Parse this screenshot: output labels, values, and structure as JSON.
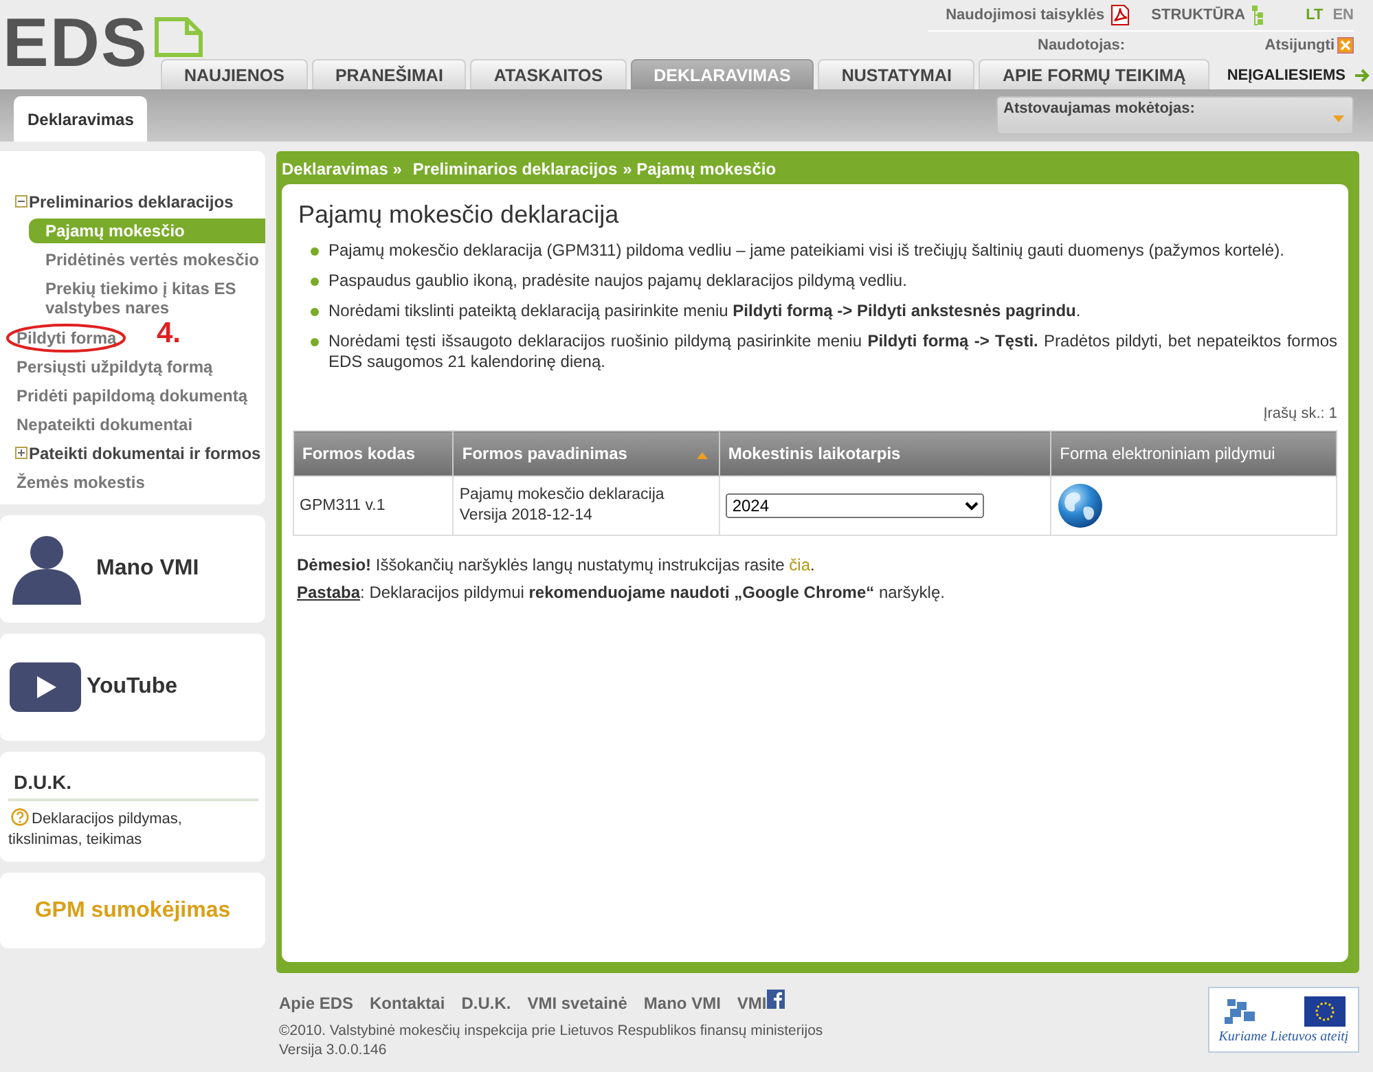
{
  "logo": {
    "text": "EDS"
  },
  "top_links": [
    {
      "label": "Naudojimosi taisyklės",
      "kind": "pdf"
    },
    {
      "label": "STRUKTŪRA",
      "kind": "tree"
    }
  ],
  "languages": [
    {
      "label": "LT",
      "selected": true
    },
    {
      "label": "EN",
      "selected": false
    }
  ],
  "user_label": "Naudotojas:",
  "logout": "Atsijungti",
  "tabs": [
    {
      "label": "NAUJIENOS",
      "selected": false
    },
    {
      "label": "PRANEŠIMAI",
      "selected": false
    },
    {
      "label": "ATASKAITOS",
      "selected": false
    },
    {
      "label": "DEKLARAVIMAS",
      "selected": true
    },
    {
      "label": "NUSTATYMAI",
      "selected": false
    },
    {
      "label": "APIE FORMŲ TEIKIMĄ",
      "selected": false
    }
  ],
  "accessibility_link": "NEĮGALIESIEMS",
  "subheader": {
    "tab": "Deklaravimas",
    "payer_label": "Atstovaujamas mokėtojas:"
  },
  "sidebar": {
    "menu": [
      {
        "label": "Preliminarios deklaracijos",
        "kind": "group",
        "expanded": true,
        "children": [
          {
            "label": "Pajamų mokesčio",
            "selected": true
          },
          {
            "label": "Pridėtinės vertės mokesčio",
            "selected": false
          },
          {
            "label": "Prekių tiekimo į kitas ES valstybes nares",
            "selected": false
          }
        ]
      },
      {
        "label": "Pildyti formą",
        "kind": "link",
        "selected": false,
        "circled": true
      },
      {
        "label": "Persiųsti užpildytą formą",
        "kind": "link",
        "selected": false
      },
      {
        "label": "Pridėti papildomą dokumentą",
        "kind": "link",
        "selected": false
      },
      {
        "label": "Nepateikti dokumentai",
        "kind": "link",
        "selected": false
      },
      {
        "label": "Pateikti dokumentai ir formos",
        "kind": "group",
        "expanded": false
      },
      {
        "label": "Žemės mokestis",
        "kind": "link",
        "selected": false
      }
    ],
    "annotation": "4.",
    "cards": [
      {
        "kind": "person",
        "label": "Mano VMI"
      },
      {
        "kind": "video",
        "label": "YouTube"
      },
      {
        "kind": "faq",
        "title": "D.U.K.",
        "text": "Deklaracijos pildymas, tikslinimas, teikimas"
      },
      {
        "kind": "payment",
        "label": "GPM sumokėjimas"
      }
    ]
  },
  "main": {
    "breadcrumb": [
      "Deklaravimas »",
      "Preliminarios deklaracijos",
      "» Pajamų mokesčio"
    ],
    "title": "Pajamų mokesčio deklaracija",
    "bullets": [
      "Pajamų mokesčio deklaracija (GPM311) pildoma vedliu – jame pateikiami visi iš trečiųjų šaltinių gauti duomenys (pažymos kortelė).",
      "Paspaudus gaublio ikoną, pradėsite naujos pajamų deklaracijos pildymą vedliu.",
      "Norėdami tikslinti pateiktą deklaraciją pasirinkite meniu **Pildyti formą -> Pildyti ankstesnės pagrindu**.",
      "Norėdami tęsti išsaugoto deklaracijos ruošinio pildymą pasirinkite meniu **Pildyti formą -> Tęsti.** Pradėtos pildyti, bet nepateiktos formos EDS saugomos 21 kalendorinę dieną."
    ],
    "record_count": "Įrašų sk.: 1",
    "table": {
      "columns": [
        {
          "label": "Formos kodas",
          "sorted": false
        },
        {
          "label": "Formos pavadinimas",
          "sorted": true
        },
        {
          "label": "Mokestinis laikotarpis",
          "sorted": false
        },
        {
          "label": "Forma elektroniniam pildymui",
          "sorted": false
        }
      ],
      "rows": [
        {
          "code": "GPM311 v.1",
          "name": "Pajamų mokesčio deklaracija",
          "version": "Versija 2018-12-14",
          "period": "2024"
        }
      ]
    },
    "notes": [
      {
        "text": "**Dėmesio!** Iššokančių naršyklės langų nustatymų instrukcijas rasite ",
        "link": "čia",
        "after": "."
      },
      {
        "lead": "Pastaba",
        "text": ": Deklaracijos pildymui **rekomenduojame naudoti „Google Chrome“** naršyklę."
      }
    ]
  },
  "footer": {
    "links": [
      "Apie EDS",
      "Kontaktai",
      "D.U.K.",
      "VMI svetainė",
      "Mano VMI",
      "VMI"
    ],
    "copyright": "©2010. Valstybinė mokesčių inspekcija prie Lietuvos Respublikos finansų ministerijos",
    "version": "Versija 3.0.0.146",
    "eu_slogan": "Kuriame Lietuvos ateitį"
  }
}
